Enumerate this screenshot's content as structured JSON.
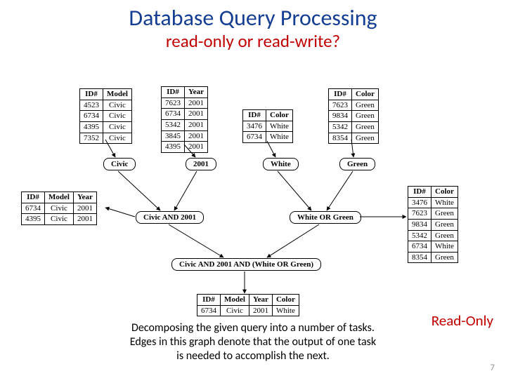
{
  "title": "Database Query Processing",
  "subtitle": "read-only or read-write?",
  "readonly_label": "Read-Only",
  "caption_l1": "Decomposing the given query into a number of tasks.",
  "caption_l2": "Edges in this graph denote that the output of one task",
  "caption_l3": "is needed to accomplish the next.",
  "page_num": "7",
  "tables": {
    "model": {
      "h1": "ID#",
      "h2": "Model",
      "rows": [
        [
          "4523",
          "Civic"
        ],
        [
          "6734",
          "Civic"
        ],
        [
          "4395",
          "Civic"
        ],
        [
          "7352",
          "Civic"
        ]
      ]
    },
    "year": {
      "h1": "ID#",
      "h2": "Year",
      "rows": [
        [
          "7623",
          "2001"
        ],
        [
          "6734",
          "2001"
        ],
        [
          "5342",
          "2001"
        ],
        [
          "3845",
          "2001"
        ],
        [
          "4395",
          "2001"
        ]
      ]
    },
    "color_l": {
      "h1": "ID#",
      "h2": "Color",
      "rows": [
        [
          "3476",
          "White"
        ],
        [
          "6734",
          "White"
        ]
      ]
    },
    "color_r": {
      "h1": "ID#",
      "h2": "Color",
      "rows": [
        [
          "7623",
          "Green"
        ],
        [
          "9834",
          "Green"
        ],
        [
          "5342",
          "Green"
        ],
        [
          "8354",
          "Green"
        ]
      ]
    },
    "join_left": {
      "h1": "ID#",
      "h2": "Model",
      "h3": "Year",
      "rows": [
        [
          "6734",
          "Civic",
          "2001"
        ],
        [
          "4395",
          "Civic",
          "2001"
        ]
      ]
    },
    "join_right": {
      "h1": "ID#",
      "h2": "Color",
      "rows": [
        [
          "3476",
          "White"
        ],
        [
          "7623",
          "Green"
        ],
        [
          "9834",
          "Green"
        ],
        [
          "5342",
          "Green"
        ],
        [
          "6734",
          "White"
        ],
        [
          "8354",
          "Green"
        ]
      ]
    },
    "final": {
      "h1": "ID#",
      "h2": "Model",
      "h3": "Year",
      "h4": "Color",
      "rows": [
        [
          "6734",
          "Civic",
          "2001",
          "White"
        ]
      ]
    }
  },
  "nodes": {
    "civic": "Civic",
    "y2001": "2001",
    "white": "White",
    "green": "Green",
    "civic_2001": "Civic AND 2001",
    "white_green": "White OR Green",
    "all": "Civic AND 2001 AND (White OR Green)"
  }
}
